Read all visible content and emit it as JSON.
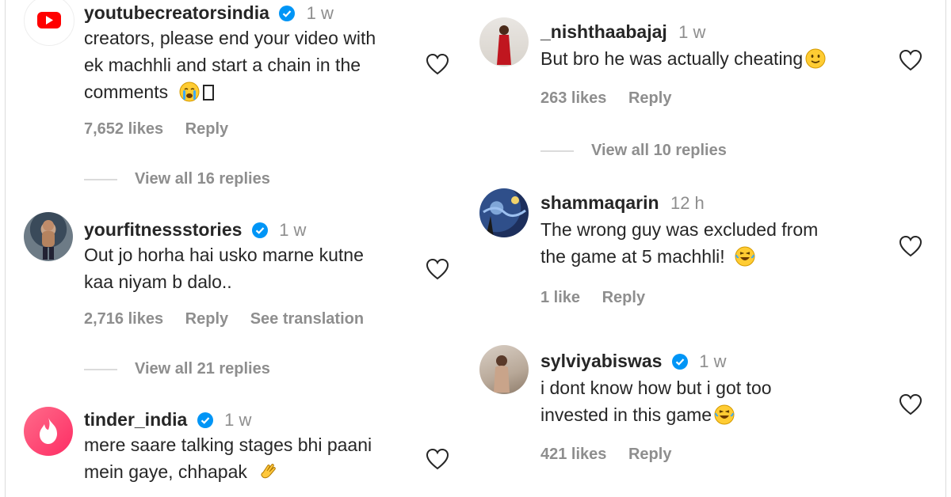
{
  "left_comments": [
    {
      "username": "youtubecreatorsindia",
      "verified": true,
      "time": "1 w",
      "lines": [
        "creators, please end your video with",
        "ek machhli and start a chain in the",
        "comments"
      ],
      "likes": "7,652 likes",
      "reply": "Reply",
      "view_replies": "View all 16 replies",
      "avatar": "youtube-logo"
    },
    {
      "username": "yourfitnessstories",
      "verified": true,
      "time": "1 w",
      "lines": [
        "Out jo horha hai usko marne kutne",
        "kaa niyam b dalo.."
      ],
      "likes": "2,716 likes",
      "reply": "Reply",
      "see_translation": "See translation",
      "view_replies": "View all 21 replies",
      "avatar": "photo"
    },
    {
      "username": "tinder_india",
      "verified": true,
      "time": "1 w",
      "lines": [
        "mere saare talking stages bhi paani",
        "mein gaye, chhapak"
      ],
      "avatar": "tinder-logo"
    }
  ],
  "right_comments": [
    {
      "username": "_nishthaabajaj",
      "verified": false,
      "time": "1 w",
      "lines": [
        "But bro he was actually cheating"
      ],
      "likes": "263 likes",
      "reply": "Reply",
      "view_replies": "View all 10 replies",
      "avatar": "photo"
    },
    {
      "username": "shammaqarin",
      "verified": false,
      "time": "12 h",
      "lines": [
        "The wrong guy was excluded from",
        "the game at 5 machhli!"
      ],
      "likes": "1 like",
      "reply": "Reply",
      "avatar": "photo"
    },
    {
      "username": "sylviyabiswas",
      "verified": true,
      "time": "1 w",
      "lines": [
        "i dont know how but i got too",
        "invested in this game"
      ],
      "likes": "421 likes",
      "reply": "Reply",
      "avatar": "photo"
    }
  ],
  "colors": {
    "text": "#262626",
    "muted": "#8e8e8e",
    "verified": "#0095f6",
    "youtube": "#ff0000",
    "tinder": "#fd3a6a"
  }
}
